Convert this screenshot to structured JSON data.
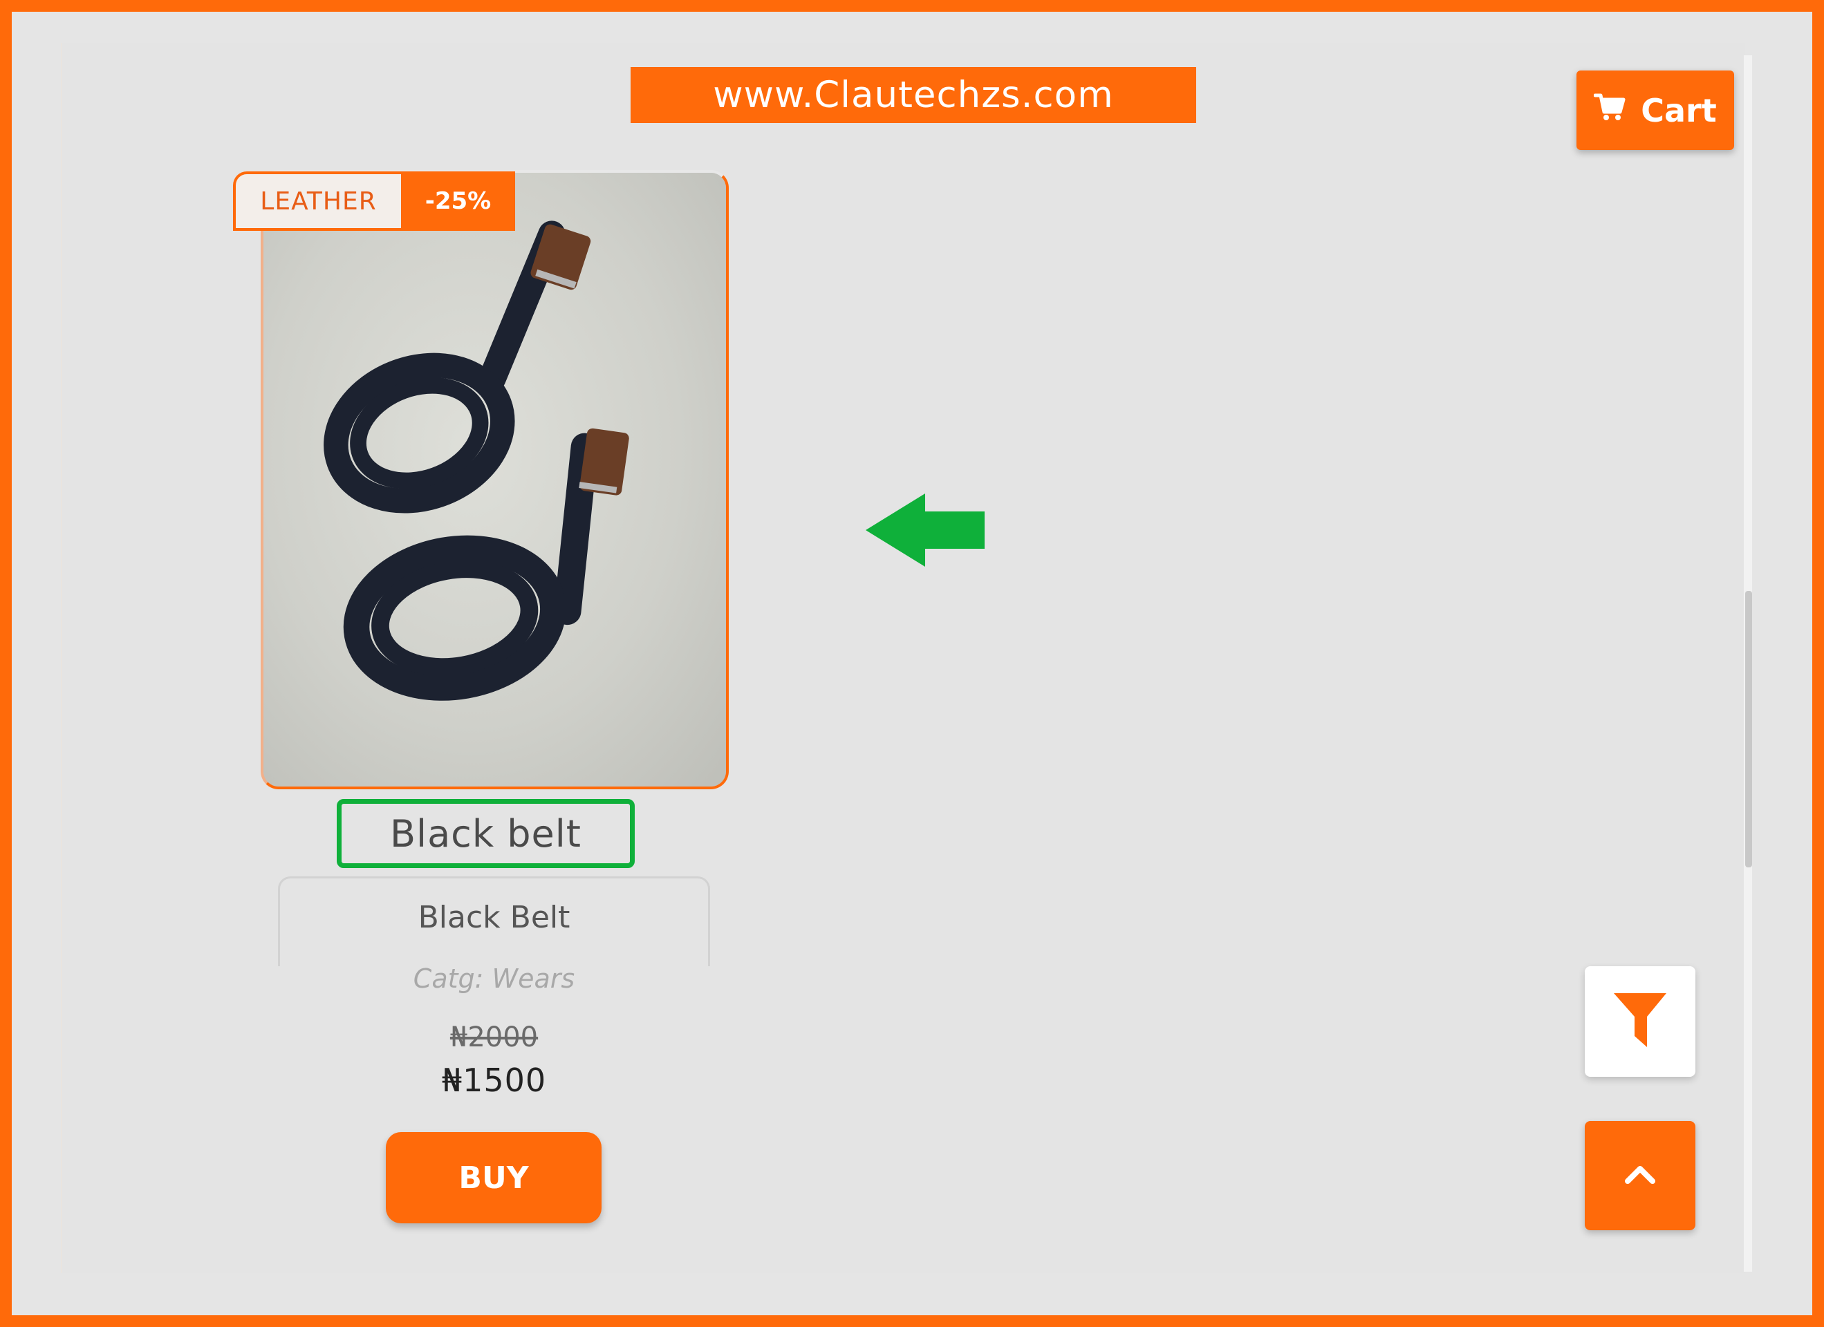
{
  "watermark": {
    "text": "www.Clautechzs.com"
  },
  "header": {
    "cart_label": "Cart",
    "cart_icon": "cart-icon"
  },
  "product": {
    "tag": "LEATHER",
    "discount": "-25%",
    "title": "Black belt",
    "name": "Black Belt",
    "category": "Catg: Wears",
    "old_price": "₦2000",
    "price": "₦1500",
    "buy_label": "BUY"
  },
  "floating": {
    "filter_icon": "filter-icon",
    "scroll_top_icon": "chevron-up-icon"
  },
  "colors": {
    "accent": "#ff6a0a",
    "highlight": "#0fb03a",
    "background": "#e5e5e5"
  }
}
